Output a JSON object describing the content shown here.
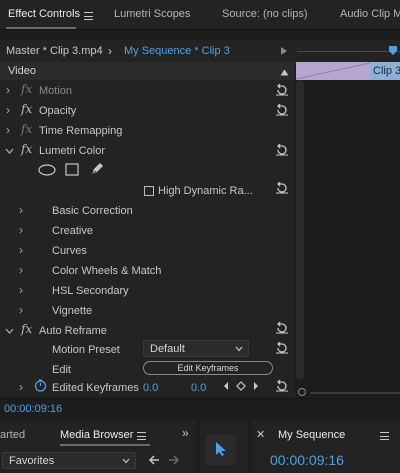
{
  "tabs": {
    "effect_controls": "Effect Controls",
    "lumetri_scopes": "Lumetri Scopes",
    "source": "Source: (no clips)",
    "audio_clip": "Audio Clip M"
  },
  "source_row": {
    "master": "Master * Clip 3.mp4",
    "sequence_clip": "My Sequence * Clip 3",
    "clip_label": "Clip 3"
  },
  "video_header": "Video",
  "effects": [
    {
      "label": "Motion"
    },
    {
      "label": "Opacity"
    },
    {
      "label": "Time Remapping"
    },
    {
      "label": "Lumetri Color"
    }
  ],
  "lumetri": {
    "hdr_label": "High Dynamic Ra...",
    "sections": [
      "Basic Correction",
      "Creative",
      "Curves",
      "Color Wheels & Match",
      "HSL Secondary",
      "Vignette"
    ]
  },
  "auto_reframe": {
    "label": "Auto Reframe",
    "motion_preset_label": "Motion Preset",
    "motion_preset_value": "Default",
    "edit_label": "Edit",
    "edit_button": "Edit Keyframes",
    "edited_keyframes_label": "Edited Keyframes",
    "kf_value_1": "0.0",
    "kf_value_2": "0.0"
  },
  "timecode": "00:00:09:16",
  "bottom": {
    "left_tab": "arted",
    "media_browser": "Media Browser",
    "favorites": "Favorites",
    "program": "My Sequence",
    "program_timecode": "00:00:09:16"
  },
  "colors": {
    "accent_blue": "#4ea0e8",
    "clip_purple": "#b9a6cf",
    "clip_blue": "#8cb0d6"
  }
}
